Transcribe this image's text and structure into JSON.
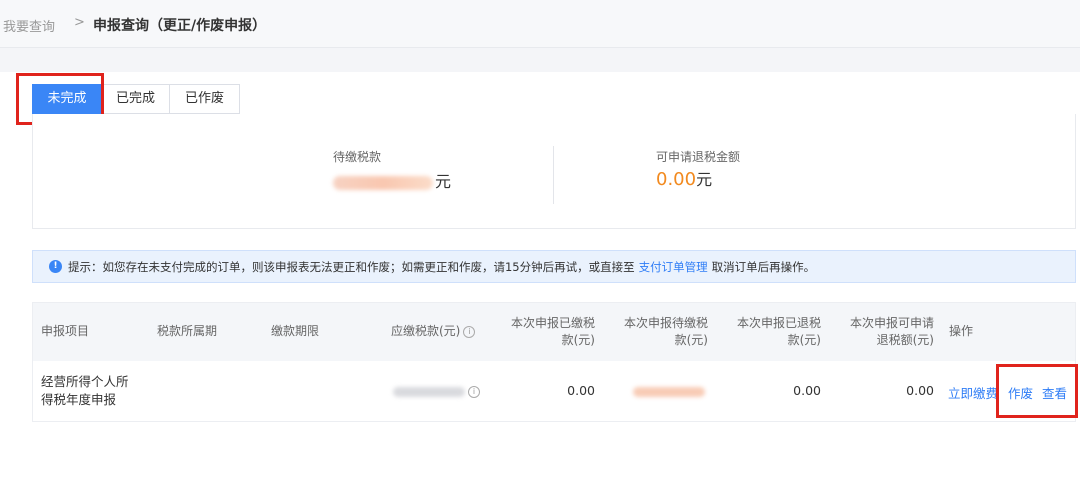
{
  "breadcrumb": {
    "root": "我要查询",
    "separator": ">",
    "current": "申报查询（更正/作废申报）"
  },
  "tabs": [
    {
      "label": "未完成",
      "active": true
    },
    {
      "label": "已完成",
      "active": false
    },
    {
      "label": "已作废",
      "active": false
    }
  ],
  "summary": {
    "pending_label": "待缴税款",
    "pending_unit": "元",
    "refund_label": "可申请退税金额",
    "refund_value": "0.00",
    "refund_unit": "元"
  },
  "notice": {
    "prefix": "提示：如您存在未支付完成的订单，则该申报表无法更正和作废；如需更正和作废，请15分钟后再试，或直接至",
    "link": "支付订单管理",
    "suffix": "取消订单后再操作。"
  },
  "table": {
    "headers": {
      "item": "申报项目",
      "period": "税款所属期",
      "deadline": "缴款期限",
      "payable": "应缴税款(元)",
      "paid_line1": "本次申报已缴税",
      "paid_line2": "款(元)",
      "topay_line1": "本次申报待缴税",
      "topay_line2": "款(元)",
      "refunded_line1": "本次申报已退税",
      "refunded_line2": "款(元)",
      "refundable_line1": "本次申报可申请",
      "refundable_line2": "退税额(元)",
      "ops": "操作"
    },
    "rows": [
      {
        "item_line1": "经营所得个人所",
        "item_line2": "得税年度申报",
        "paid": "0.00",
        "refunded": "0.00",
        "refundable": "0.00",
        "op_pay": "立即缴费",
        "op_void": "作废",
        "op_view": "查看"
      }
    ]
  },
  "colors": {
    "accent": "#3a86f6",
    "highlight": "#e0231c",
    "amount": "#f28a1f"
  }
}
